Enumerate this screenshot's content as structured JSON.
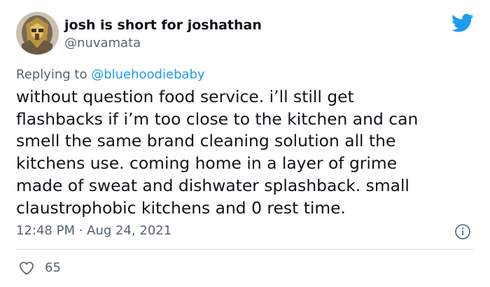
{
  "author": {
    "display_name": "josh is short for joshathan",
    "handle": "@nuvamata",
    "avatar_icon": "robot-mask-avatar"
  },
  "brand_icon": "twitter-bird-icon",
  "reply": {
    "prefix": "Replying to",
    "mention": "@bluehoodiebaby"
  },
  "text_lines": [
    "without question food service. i’ll still get",
    "flashbacks if i’m too close to the kitchen and can",
    "smell the same brand cleaning solution all the",
    "kitchens use. coming home in a layer of grime",
    "made of sweat and dishwater splashback. small",
    "claustrophobic kitchens and 0 rest time."
  ],
  "timestamp": "12:48 PM · Aug 24, 2021",
  "stats": {
    "likes": "65"
  },
  "colors": {
    "accent": "#1d9bf0",
    "text": "#0f1419",
    "muted": "#536471",
    "divider": "#cfd9de"
  }
}
